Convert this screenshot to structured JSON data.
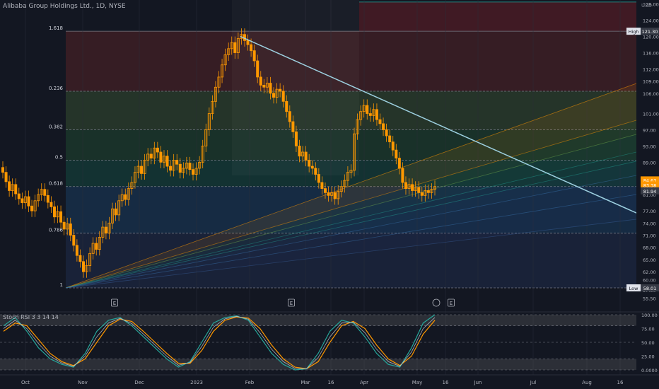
{
  "title": "Alibaba Group Holdings Ltd., 1D, NYSE",
  "currency": "USD",
  "indicator_label": "Stoch RSI 3 3 14 14",
  "colors": {
    "background": "#131722",
    "candle": "#ff9800",
    "trendline": "#9dd0e0",
    "fib_line": "#787b86",
    "k_line": "#26a69a",
    "d_line": "#ff9800",
    "price_tag_orange": "#ff9800",
    "price_tag_gray": "#363a45"
  },
  "chart_data": {
    "type": "candlestick",
    "price_axis": {
      "ticks": [
        "128.00",
        "124.00",
        "120.00",
        "116.00",
        "112.00",
        "109.00",
        "106.00",
        "101.00",
        "97.00",
        "93.00",
        "89.00",
        "85.00",
        "81.00",
        "77.00",
        "74.00",
        "71.00",
        "68.00",
        "65.00",
        "62.00",
        "60.00",
        "57.50",
        "55.50"
      ],
      "ylim": [
        54,
        129
      ]
    },
    "time_axis": [
      "Oct",
      "Nov",
      "Dec",
      "2023",
      "Feb",
      "Mar",
      "16",
      "Apr",
      "May",
      "16",
      "Jun",
      "Jul",
      "Aug",
      "16"
    ],
    "fib_levels": [
      {
        "label": "1.618",
        "price": 121.3
      },
      {
        "label": "0.236",
        "price": 106.5
      },
      {
        "label": "0.382",
        "price": 97.0
      },
      {
        "label": "0.5",
        "price": 89.5
      },
      {
        "label": "0.618",
        "price": 83.0
      },
      {
        "label": "0.786",
        "price": 71.5
      },
      {
        "label": "1",
        "price": 58.01
      }
    ],
    "price_tags": [
      {
        "label": "High",
        "value": "121.30"
      },
      {
        "label": "",
        "value": "84.63"
      },
      {
        "label": "",
        "value": "83.38"
      },
      {
        "label": "",
        "value": "81.94"
      },
      {
        "label": "Low",
        "value": "58.01"
      }
    ],
    "trendline": {
      "from": {
        "date": "2023-01-27",
        "price": 120.0
      },
      "to": {
        "date": "2023-08-31",
        "price": 75.0
      }
    },
    "candles_close": [
      86.5,
      84.2,
      82.0,
      83.5,
      81.2,
      80.0,
      79.0,
      80.5,
      78.2,
      77.0,
      79.5,
      81.0,
      82.3,
      80.8,
      79.1,
      78.0,
      75.5,
      76.8,
      74.2,
      72.5,
      73.8,
      71.0,
      68.5,
      66.0,
      64.5,
      62.0,
      63.5,
      66.5,
      69.0,
      67.5,
      70.5,
      73.0,
      71.5,
      74.0,
      77.5,
      76.0,
      79.5,
      81.0,
      79.8,
      82.5,
      84.0,
      86.5,
      88.0,
      86.2,
      89.5,
      91.0,
      90.0,
      92.5,
      91.5,
      89.0,
      90.5,
      88.0,
      87.0,
      89.5,
      88.5,
      86.5,
      87.5,
      88.8,
      87.2,
      86.0,
      87.5,
      89.0,
      93.0,
      97.0,
      101.0,
      104.0,
      107.5,
      110.0,
      113.0,
      115.5,
      117.0,
      118.5,
      116.0,
      119.5,
      120.5,
      119.0,
      118.0,
      116.5,
      114.0,
      110.0,
      108.0,
      107.5,
      108.5,
      106.0,
      105.0,
      107.0,
      106.5,
      104.0,
      101.5,
      99.0,
      96.5,
      93.0,
      90.5,
      91.5,
      89.5,
      88.0,
      87.5,
      86.0,
      84.0,
      82.5,
      81.5,
      80.8,
      81.5,
      80.0,
      81.8,
      83.0,
      84.5,
      86.5,
      87.0,
      96.0,
      99.5,
      101.5,
      103.0,
      101.0,
      100.5,
      102.0,
      99.5,
      98.5,
      97.0,
      95.5,
      94.0,
      92.0,
      90.0,
      87.5,
      84.0,
      82.5,
      83.5,
      82.0,
      82.8,
      81.5,
      80.8,
      82.0,
      81.5,
      82.3,
      83.0
    ],
    "stoch_k_points": [
      80,
      95,
      70,
      40,
      20,
      10,
      5,
      30,
      70,
      90,
      95,
      80,
      60,
      40,
      20,
      5,
      15,
      50,
      85,
      95,
      98,
      90,
      60,
      30,
      10,
      0,
      2,
      30,
      70,
      90,
      85,
      60,
      30,
      10,
      5,
      40,
      85,
      100
    ],
    "stoch_d_points": [
      70,
      85,
      80,
      55,
      30,
      15,
      8,
      20,
      50,
      80,
      92,
      88,
      70,
      50,
      30,
      12,
      12,
      35,
      70,
      90,
      96,
      94,
      75,
      45,
      20,
      5,
      2,
      15,
      50,
      80,
      88,
      75,
      45,
      20,
      8,
      25,
      65,
      90
    ],
    "stoch_axis": [
      "100.00",
      "75.00",
      "50.00",
      "25.00",
      "0.0000"
    ]
  }
}
